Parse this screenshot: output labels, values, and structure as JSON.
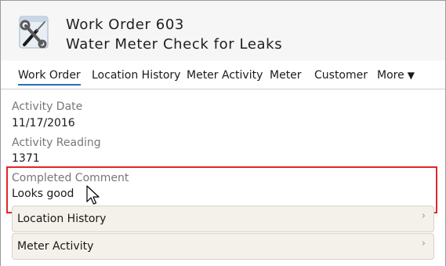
{
  "header": {
    "title": "Work Order 603",
    "subtitle": "Water Meter Check for Leaks",
    "icon": "wrench-screwdriver-icon"
  },
  "tabs": [
    {
      "label": "Work Order",
      "active": true
    },
    {
      "label": "Location History",
      "active": false
    },
    {
      "label": "Meter Activity",
      "active": false
    },
    {
      "label": "Meter",
      "active": false
    },
    {
      "label": "Customer",
      "active": false
    },
    {
      "label": "More",
      "active": false,
      "icon": "caret-down-icon",
      "caret": "▼"
    }
  ],
  "fields": [
    {
      "label": "Activity Date",
      "value": "11/17/2016"
    },
    {
      "label": "Activity Reading",
      "value": "1371"
    },
    {
      "label": "Completed Comment",
      "value": "Looks good"
    }
  ],
  "sections": [
    {
      "label": "Location History",
      "chevron": "›"
    },
    {
      "label": "Meter Activity",
      "chevron": "›"
    }
  ],
  "colors": {
    "tab_underline": "#2a6fbb",
    "highlight": "#e2262b"
  }
}
